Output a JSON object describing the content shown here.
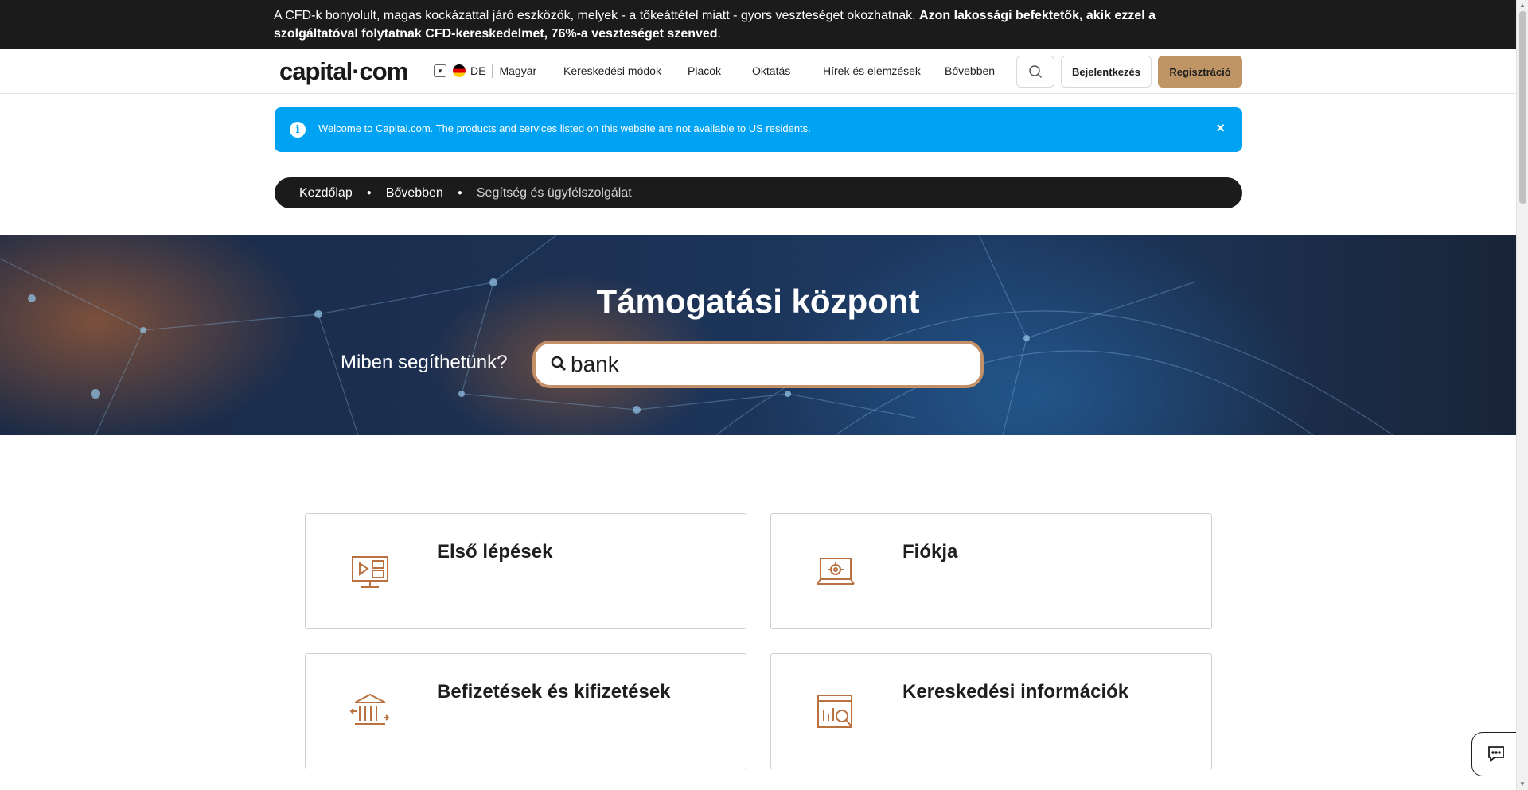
{
  "risk_banner": {
    "text": "A CFD-k bonyolult, magas kockázattal járó eszközök, melyek - a tőkeáttétel miatt - gyors veszteséget okozhatnak. ",
    "bold_text": "Azon lakossági befektetők, akik ezzel a szolgáltatóval folytatnak CFD-kereskedelmet, 76%-a veszteséget szenved",
    "end": "."
  },
  "header": {
    "logo": "capital·com",
    "region": "DE",
    "language": "Magyar",
    "nav": [
      "Kereskedési módok",
      "Piacok",
      "Oktatás",
      "Hírek és elemzések",
      "Bővebben"
    ],
    "login": "Bejelentkezés",
    "register": "Regisztráció"
  },
  "info_bar": {
    "text": "Welcome to Capital.com. The products and services listed on this website are not available to US residents.",
    "close": "×"
  },
  "breadcrumb": [
    "Kezdőlap",
    "Bővebben",
    "Segítség és ügyfélszolgálat"
  ],
  "hero": {
    "title": "Támogatási központ",
    "prompt": "Miben segíthetünk?",
    "search_value": "bank"
  },
  "cards": [
    {
      "title": "Első lépések",
      "icon": "video-screen-icon"
    },
    {
      "title": "Fiókja",
      "icon": "laptop-gear-icon"
    },
    {
      "title": "Befizetések és kifizetések",
      "icon": "bank-transfer-icon"
    },
    {
      "title": "Kereskedési információk",
      "icon": "chart-search-icon"
    }
  ],
  "colors": {
    "accent": "#c09565",
    "info_blue": "#00a2f3",
    "dark": "#1b1b1b",
    "icon_orange": "#b9713f"
  }
}
